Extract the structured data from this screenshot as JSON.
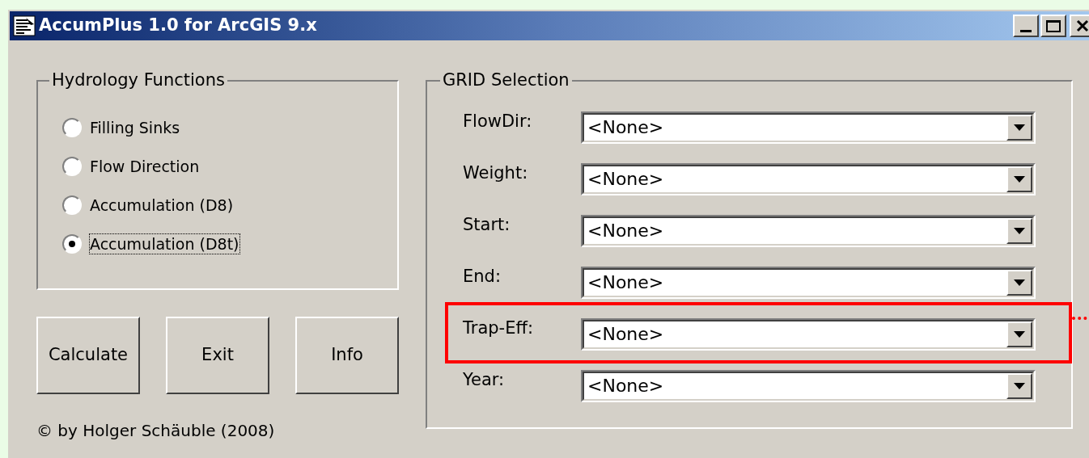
{
  "window": {
    "title": "AccumPlus 1.0 for ArcGIS 9.x"
  },
  "hydrology_functions": {
    "title": "Hydrology Functions",
    "options": [
      {
        "label": "Filling Sinks",
        "selected": false
      },
      {
        "label": "Flow Direction",
        "selected": false
      },
      {
        "label": "Accumulation (D8)",
        "selected": false
      },
      {
        "label": "Accumulation (D8t)",
        "selected": true
      }
    ]
  },
  "buttons": [
    "Calculate",
    "Exit",
    "Info"
  ],
  "copyright": "© by Holger Schäuble (2008)",
  "grid_selection": {
    "title": "GRID Selection",
    "rows": [
      {
        "label": "FlowDir:",
        "value": "<None>",
        "highlighted": false
      },
      {
        "label": "Weight:",
        "value": "<None>",
        "highlighted": false
      },
      {
        "label": "Start:",
        "value": "<None>",
        "highlighted": false
      },
      {
        "label": "End:",
        "value": "<None>",
        "highlighted": false
      },
      {
        "label": "Trap-Eff:",
        "value": "<None>",
        "highlighted": true
      },
      {
        "label": "Year:",
        "value": "<None>",
        "highlighted": false
      }
    ]
  }
}
